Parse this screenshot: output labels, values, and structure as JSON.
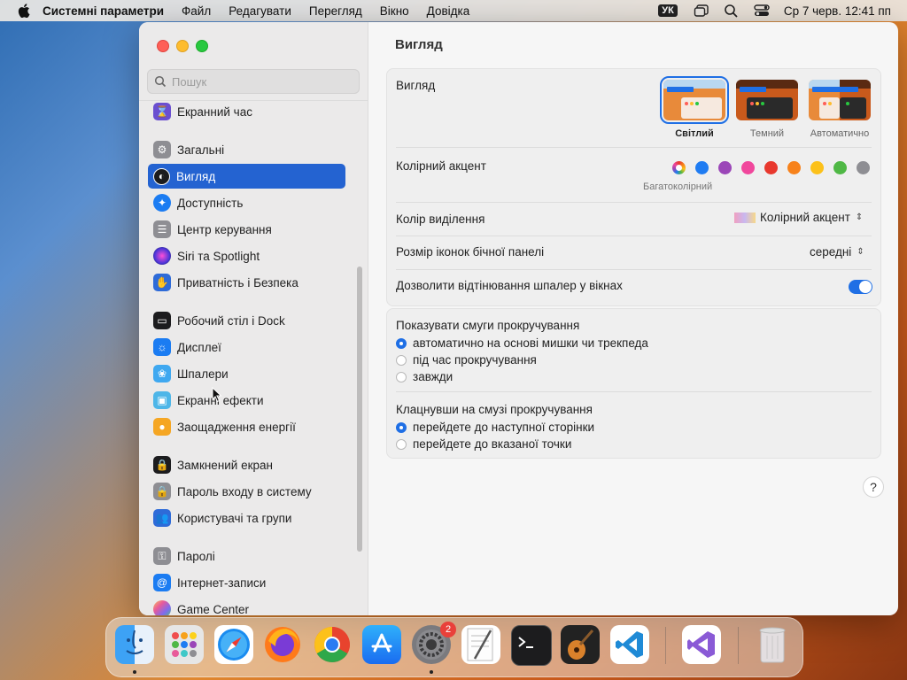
{
  "menubar": {
    "app_name": "Системні параметри",
    "items": [
      "Файл",
      "Редагувати",
      "Перегляд",
      "Вікно",
      "Довідка"
    ],
    "input_source": "УК",
    "clock": "Ср 7 черв.  12:41 пп"
  },
  "sidebar": {
    "search_placeholder": "Пошук",
    "items": [
      {
        "label": "Екранний час",
        "icon": "hourglass-icon",
        "color": "#6a4fd0"
      },
      {
        "label": "Загальні",
        "icon": "gear-icon",
        "color": "#8e8e93"
      },
      {
        "label": "Вигляд",
        "icon": "appearance-icon",
        "color": "#1c1c1e"
      },
      {
        "label": "Доступність",
        "icon": "accessibility-icon",
        "color": "#1b7cf2"
      },
      {
        "label": "Центр керування",
        "icon": "control-center-icon",
        "color": "#8e8e93"
      },
      {
        "label": "Siri та Spotlight",
        "icon": "siri-icon",
        "color": "#c03fe0"
      },
      {
        "label": "Приватність і Безпека",
        "icon": "hand-icon",
        "color": "#2e6bd8"
      },
      {
        "label": "Робочий стіл і Dock",
        "icon": "dock-icon",
        "color": "#1c1c1e"
      },
      {
        "label": "Дисплеї",
        "icon": "display-icon",
        "color": "#1b7cf2"
      },
      {
        "label": "Шпалери",
        "icon": "wallpaper-icon",
        "color": "#3fa8f0"
      },
      {
        "label": "Екранні ефекти",
        "icon": "screensaver-icon",
        "color": "#4eb6e8"
      },
      {
        "label": "Заощадження енергії",
        "icon": "bulb-icon",
        "color": "#f5a623"
      },
      {
        "label": "Замкнений екран",
        "icon": "lock-screen-icon",
        "color": "#1c1c1e"
      },
      {
        "label": "Пароль входу в систему",
        "icon": "lock-icon",
        "color": "#8e8e93"
      },
      {
        "label": "Користувачі та групи",
        "icon": "users-icon",
        "color": "#2e6bd8"
      },
      {
        "label": "Паролі",
        "icon": "key-icon",
        "color": "#8e8e93"
      },
      {
        "label": "Інтернет-записи",
        "icon": "at-icon",
        "color": "#1b7cf2"
      },
      {
        "label": "Game Center",
        "icon": "game-center-icon",
        "color": "#e85a9a"
      }
    ],
    "selected_index": 2
  },
  "main": {
    "title": "Вигляд",
    "appearance": {
      "label": "Вигляд",
      "options": [
        "Світлий",
        "Темний",
        "Автоматично"
      ],
      "selected": "Світлий"
    },
    "accent": {
      "label": "Колірний акцент",
      "caption": "Багатоколірний",
      "colors": [
        "#8e8e93",
        "#1f7cf2",
        "#9b46b8",
        "#f0479c",
        "#e8382e",
        "#f7821b",
        "#fcc11a",
        "#4fb845",
        "#8e8e93"
      ]
    },
    "highlight": {
      "label": "Колір виділення",
      "value": "Колірний акцент"
    },
    "sidebar_icon_size": {
      "label": "Розмір іконок бічної панелі",
      "value": "середні"
    },
    "wallpaper_tinting": {
      "label": "Дозволити відтінювання шпалер у вікнах",
      "enabled": true
    },
    "scrollbars": {
      "title": "Показувати смуги прокручування",
      "options": [
        "автоматично на основі мишки чи трекпеда",
        "під час прокручування",
        "завжди"
      ],
      "selected_index": 0
    },
    "click_scrollbar": {
      "title": "Клацнувши на смузі прокручування",
      "options": [
        "перейдете до наступної сторінки",
        "перейдете до вказаної точки"
      ],
      "selected_index": 0
    },
    "help": "?"
  },
  "dock": {
    "apps": [
      {
        "name": "finder",
        "running": true
      },
      {
        "name": "launchpad",
        "running": false
      },
      {
        "name": "safari",
        "running": false
      },
      {
        "name": "firefox",
        "running": false
      },
      {
        "name": "chrome",
        "running": false
      },
      {
        "name": "app-store",
        "running": false
      },
      {
        "name": "system-settings",
        "running": true,
        "badge": "2"
      },
      {
        "name": "textedit",
        "running": false
      },
      {
        "name": "terminal",
        "running": false
      },
      {
        "name": "garageband",
        "running": false
      },
      {
        "name": "vscode",
        "running": false
      },
      {
        "name": "visual-studio",
        "running": false
      },
      {
        "name": "trash",
        "running": false
      }
    ]
  }
}
